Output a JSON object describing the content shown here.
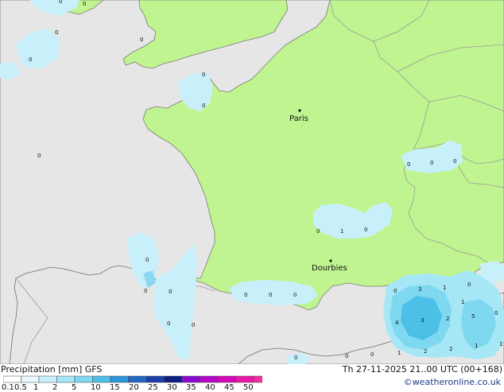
{
  "header": {
    "title_left": "Precipitation [mm]  GFS",
    "title_right": "Th 27-11-2025 21..00 UTC (00+168)",
    "credit": "©weatheronline.co.uk"
  },
  "cities": [
    {
      "name": "Paris"
    },
    {
      "name": "Dourbies"
    }
  ],
  "legend": {
    "ticks": [
      "0.1",
      "0.5",
      "1",
      "2",
      "5",
      "10",
      "15",
      "20",
      "25",
      "30",
      "35",
      "40",
      "45",
      "50"
    ],
    "colors": [
      "#ffffff",
      "#e8f8fd",
      "#c8f0fa",
      "#a6e7f6",
      "#7ed8f0",
      "#4dc0e8",
      "#2e96d8",
      "#2466c6",
      "#1c3ea8",
      "#0d1d80",
      "#8a0ad0",
      "#b40ac8",
      "#d60ab8",
      "#e818a8",
      "#f030a0"
    ]
  },
  "map_colors": {
    "sea": "#e6e6e6",
    "land": "#c0f490",
    "border": "#9a9a9a",
    "coast": "#7a7a7a",
    "rain_light": "#c8f0fa",
    "rain_mid": "#8ad8f0",
    "rain_heavy": "#4cb6e2"
  },
  "rain_values": [
    "0",
    "0",
    "0",
    "0",
    "0",
    "0",
    "0",
    "0",
    "0",
    "0",
    "0",
    "1",
    "0",
    "0",
    "0",
    "0",
    "0",
    "0",
    "0",
    "0",
    "0",
    "0",
    "0",
    "0",
    "0",
    "0",
    "3",
    "1",
    "0",
    "4",
    "3",
    "2",
    "5",
    "1",
    "2",
    "2",
    "1",
    "1",
    "1",
    "0"
  ]
}
